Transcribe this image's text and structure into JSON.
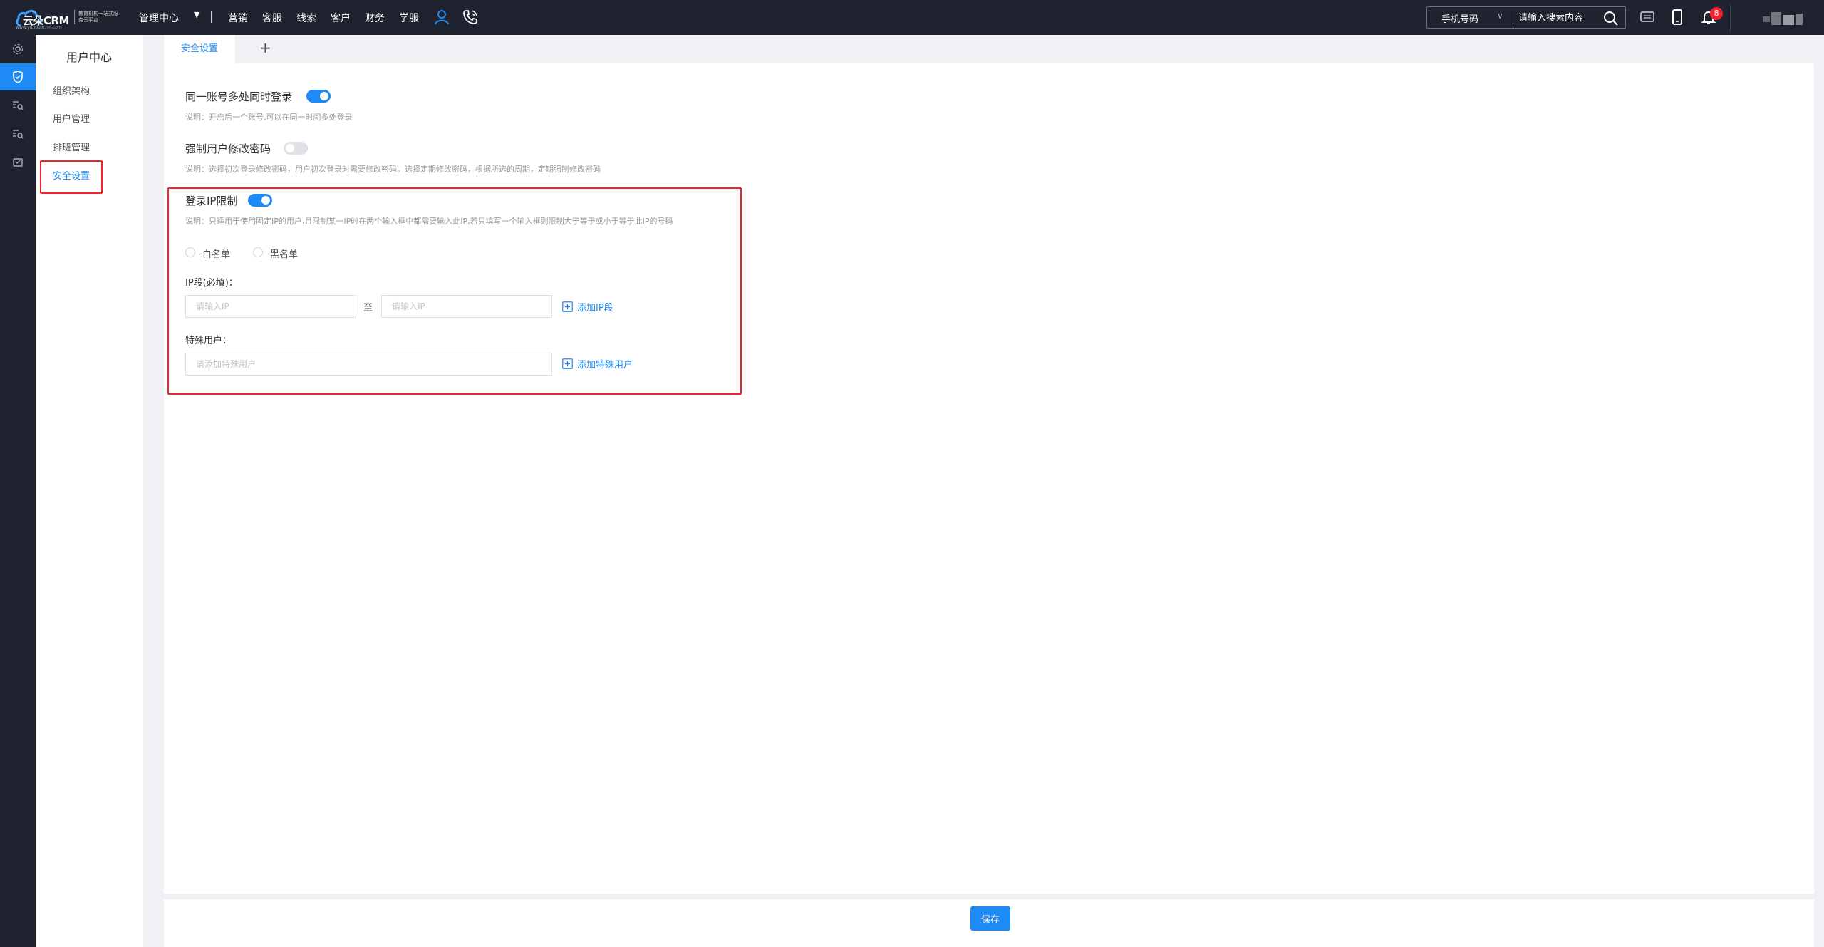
{
  "topbar": {
    "logo": {
      "name": "云朵CRM",
      "tagline": "教育机构一站式服务云平台",
      "url": "www.yunduocrm.com"
    },
    "management_center": "管理中心",
    "nav": [
      "营销",
      "客服",
      "线索",
      "客户",
      "财务",
      "学服"
    ],
    "search": {
      "type": "手机号码",
      "placeholder": "请输入搜索内容"
    },
    "notification_count": "8"
  },
  "rail": {
    "items": [
      "settings-icon",
      "shield-icon",
      "list-search-icon",
      "list-search-icon",
      "inbox-icon"
    ],
    "active_index": 1
  },
  "submenu": {
    "title": "用户中心",
    "items": [
      "组织架构",
      "用户管理",
      "排班管理",
      "安全设置"
    ],
    "active_index": 3
  },
  "tabs": {
    "active": "安全设置",
    "add": "+"
  },
  "settings": {
    "multi_login": {
      "title": "同一账号多处同时登录",
      "enabled": true,
      "desc": "说明：开启后一个账号,可以在同一时间多处登录"
    },
    "force_pwd": {
      "title": "强制用户修改密码",
      "enabled": false,
      "desc": "说明：选择初次登录修改密码，用户初次登录时需要修改密码。选择定期修改密码，根据所选的周期，定期强制修改密码"
    },
    "ip_limit": {
      "title": "登录IP限制",
      "enabled": true,
      "desc": "说明：只适用于使用固定IP的用户,且限制某一IP时在两个输入框中都需要输入此IP,若只填写一个输入框则限制大于等于或小于等于此IP的号码",
      "radio_whitelist": "白名单",
      "radio_blacklist": "黑名单",
      "ip_segment_label": "IP段(必填)：",
      "ip_placeholder": "请输入IP",
      "to": "至",
      "add_ip_segment": "添加IP段",
      "special_users_label": "特殊用户：",
      "special_users_placeholder": "请添加特殊用户",
      "add_special_user": "添加特殊用户"
    }
  },
  "footer": {
    "save": "保存"
  },
  "colors": {
    "primary": "#1e8af5",
    "topbar": "#1f2330",
    "highlight": "#f5222d"
  }
}
